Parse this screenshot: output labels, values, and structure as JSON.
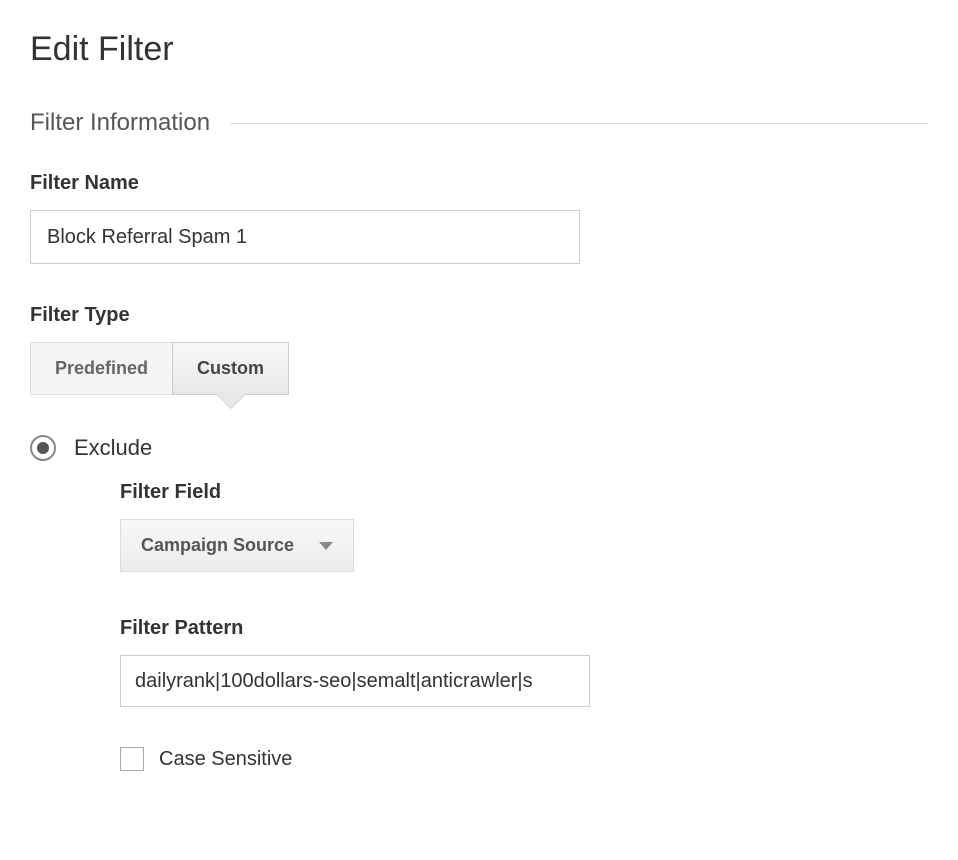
{
  "page": {
    "title": "Edit Filter"
  },
  "section": {
    "title": "Filter Information"
  },
  "filter_name": {
    "label": "Filter Name",
    "value": "Block Referral Spam 1"
  },
  "filter_type": {
    "label": "Filter Type",
    "tabs": {
      "predefined": "Predefined",
      "custom": "Custom"
    },
    "active": "custom"
  },
  "exclude": {
    "radio_label": "Exclude",
    "radio_selected": true,
    "filter_field": {
      "label": "Filter Field",
      "selected": "Campaign Source"
    },
    "filter_pattern": {
      "label": "Filter Pattern",
      "value": "dailyrank|100dollars-seo|semalt|anticrawler|s"
    },
    "case_sensitive": {
      "label": "Case Sensitive",
      "checked": false
    }
  }
}
